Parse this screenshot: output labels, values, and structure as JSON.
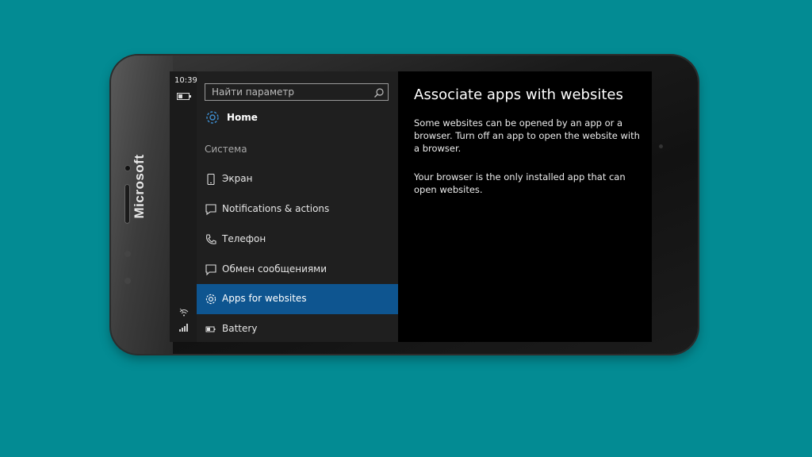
{
  "phone": {
    "brand": "Microsoft"
  },
  "statusbar": {
    "time": "10:39"
  },
  "nav": {
    "search_placeholder": "Найти параметр",
    "home_label": "Home",
    "section_label": "Система",
    "items": [
      {
        "label": "Экран",
        "icon": "display-icon"
      },
      {
        "label": "Notifications & actions",
        "icon": "notifications-icon"
      },
      {
        "label": "Телефон",
        "icon": "phone-icon"
      },
      {
        "label": "Обмен сообщениями",
        "icon": "messaging-icon"
      },
      {
        "label": "Apps for websites",
        "icon": "gear-icon",
        "selected": true
      },
      {
        "label": "Battery",
        "icon": "battery-icon"
      }
    ]
  },
  "content": {
    "title": "Associate apps with websites",
    "paragraph1": "Some websites can be opened by an app or a browser.  Turn off an app to open the website with a browser.",
    "paragraph2": "Your browser is the only installed app that can open websites."
  },
  "colors": {
    "background": "#038b93",
    "selection": "#0e5590",
    "nav_background": "#1f1f1f",
    "accent_icon": "#3e8ed0"
  }
}
